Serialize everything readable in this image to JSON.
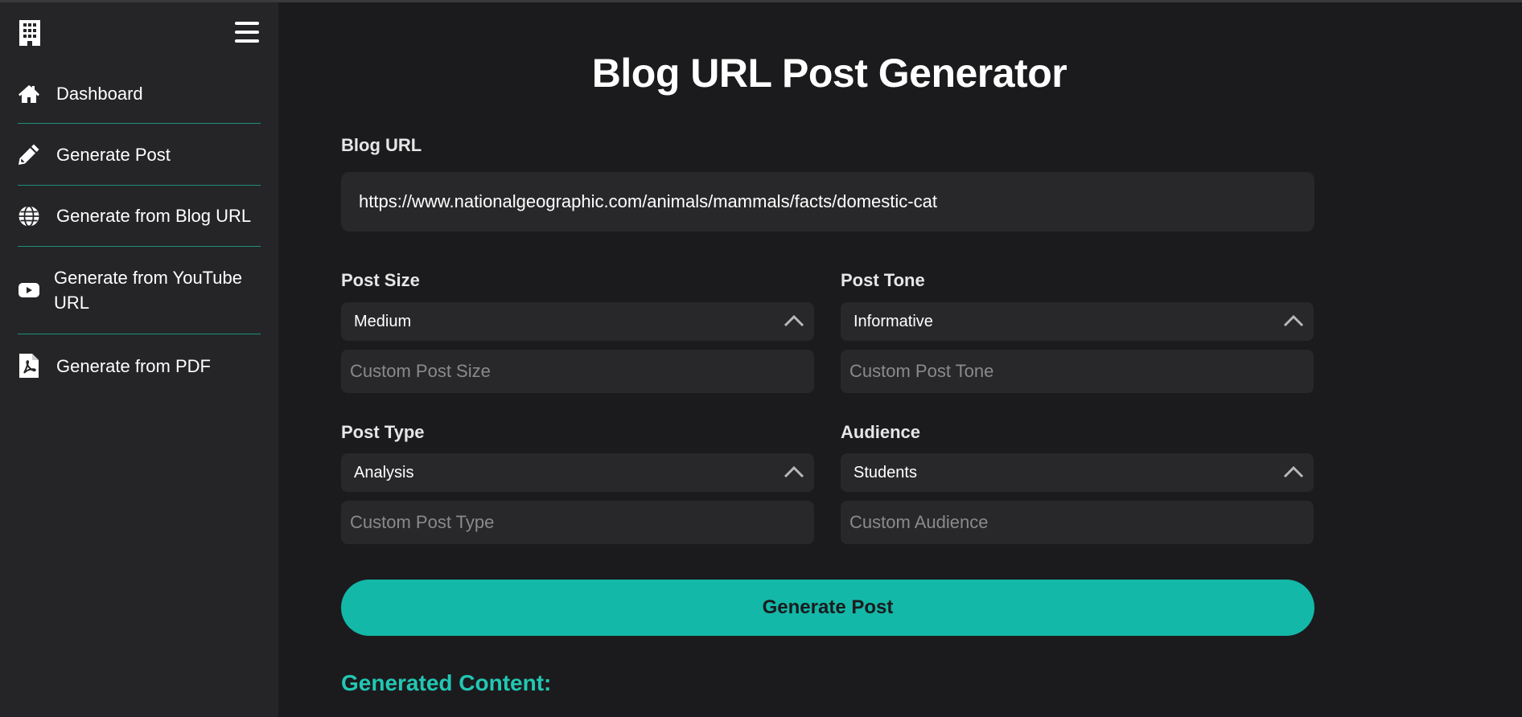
{
  "sidebar": {
    "items": [
      {
        "label": "Dashboard",
        "icon": "home-icon"
      },
      {
        "label": "Generate Post",
        "icon": "pencil-icon"
      },
      {
        "label": "Generate from Blog URL",
        "icon": "globe-icon"
      },
      {
        "label": "Generate from YouTube URL",
        "icon": "youtube-icon"
      },
      {
        "label": "Generate from PDF",
        "icon": "pdf-file-icon"
      }
    ]
  },
  "main": {
    "title": "Blog URL Post Generator",
    "blog_url": {
      "label": "Blog URL",
      "value": "https://www.nationalgeographic.com/animals/mammals/facts/domestic-cat"
    },
    "post_size": {
      "label": "Post Size",
      "selected": "Medium",
      "custom_placeholder": "Custom Post Size"
    },
    "post_tone": {
      "label": "Post Tone",
      "selected": "Informative",
      "custom_placeholder": "Custom Post Tone"
    },
    "post_type": {
      "label": "Post Type",
      "selected": "Analysis",
      "custom_placeholder": "Custom Post Type"
    },
    "audience": {
      "label": "Audience",
      "selected": "Students",
      "custom_placeholder": "Custom Audience"
    },
    "generate_button": "Generate Post",
    "generated_heading": "Generated Content:"
  },
  "colors": {
    "background": "#1b1b1d",
    "sidebar": "#252527",
    "accent": "#13b8a8",
    "accent_text": "#22c7b3",
    "divider": "#1e8e82"
  }
}
